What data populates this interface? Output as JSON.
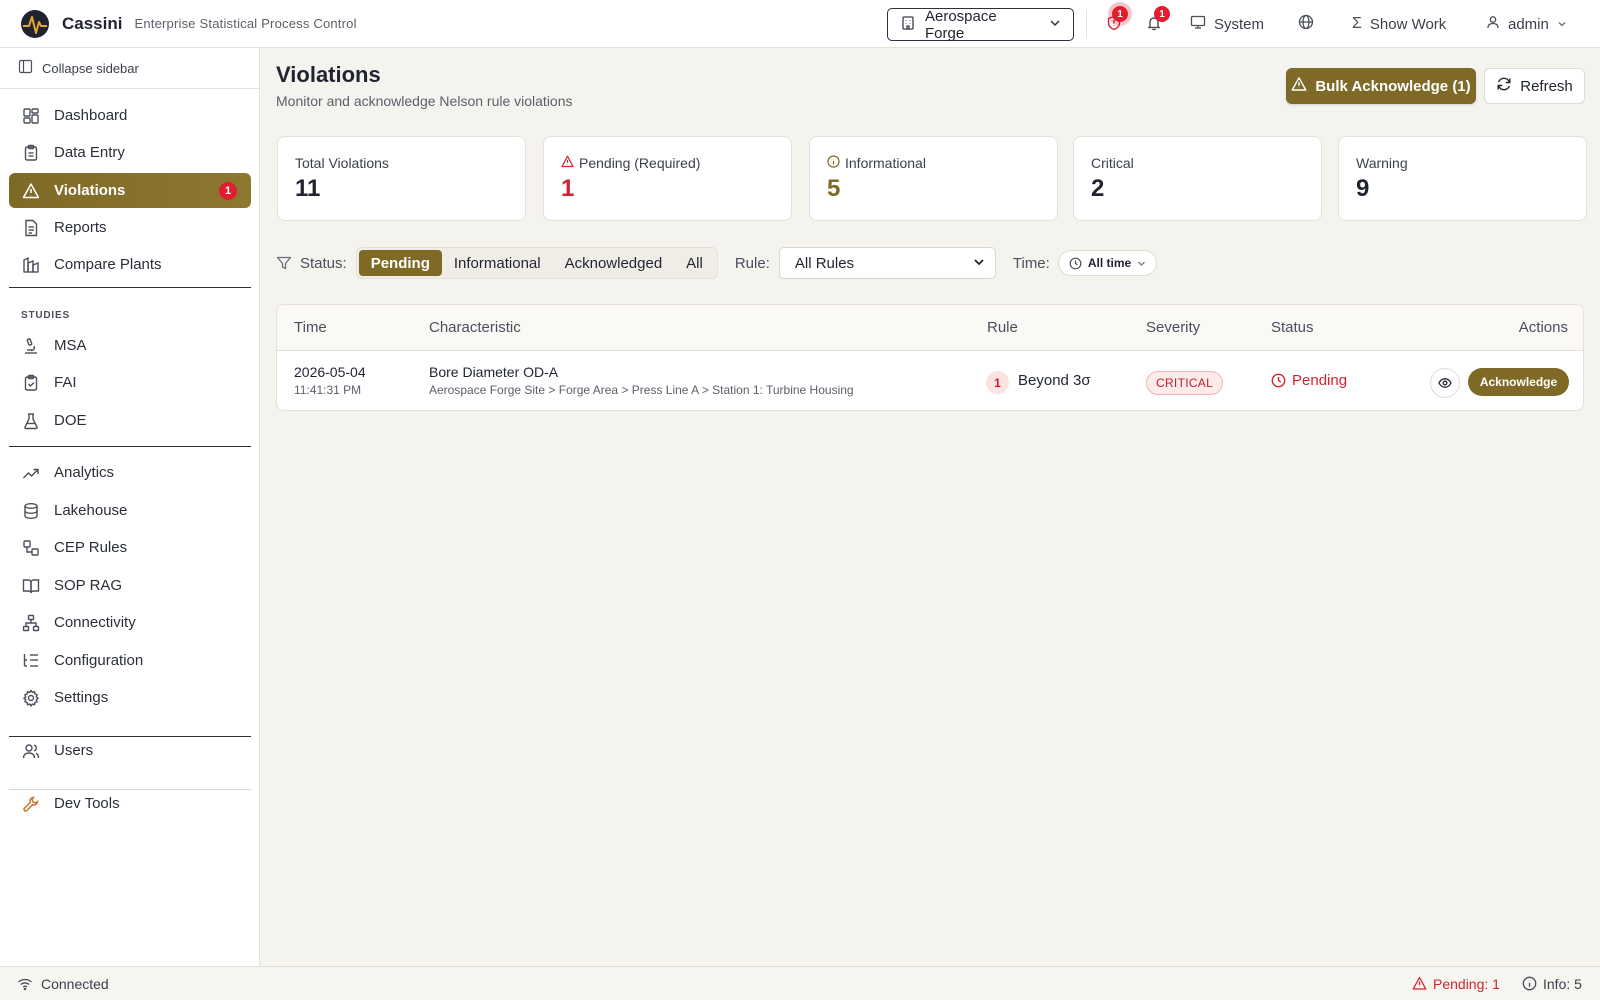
{
  "app": {
    "name": "Cassini",
    "subtitle": "Enterprise Statistical Process Control"
  },
  "topbar": {
    "plant": "Aerospace Forge",
    "violations_badge": "1",
    "notifications_badge": "1",
    "system_label": "System",
    "show_work_label": "Show Work",
    "user_label": "admin"
  },
  "sidebar": {
    "collapse_label": "Collapse sidebar",
    "main_items": [
      {
        "label": "Dashboard",
        "icon": "dashboard-icon"
      },
      {
        "label": "Data Entry",
        "icon": "clipboard-icon"
      },
      {
        "label": "Violations",
        "icon": "warning-icon",
        "active": true,
        "count": "1"
      },
      {
        "label": "Reports",
        "icon": "file-text-icon"
      },
      {
        "label": "Compare Plants",
        "icon": "factory-icon"
      }
    ],
    "studies_heading": "STUDIES",
    "study_items": [
      {
        "label": "MSA",
        "icon": "microscope-icon"
      },
      {
        "label": "FAI",
        "icon": "clipboard-check-icon"
      },
      {
        "label": "DOE",
        "icon": "flask-icon"
      }
    ],
    "tool_items": [
      {
        "label": "Analytics",
        "icon": "trending-up-icon"
      },
      {
        "label": "Lakehouse",
        "icon": "database-icon"
      },
      {
        "label": "CEP Rules",
        "icon": "workflow-icon"
      },
      {
        "label": "SOP RAG",
        "icon": "book-icon"
      },
      {
        "label": "Connectivity",
        "icon": "network-icon"
      },
      {
        "label": "Configuration",
        "icon": "list-tree-icon"
      },
      {
        "label": "Settings",
        "icon": "gear-icon"
      }
    ],
    "admin_items": [
      {
        "label": "Users",
        "icon": "users-icon"
      }
    ],
    "dev_items": [
      {
        "label": "Dev Tools",
        "icon": "wrench-icon"
      }
    ]
  },
  "page": {
    "title": "Violations",
    "subtitle": "Monitor and acknowledge Nelson rule violations",
    "bulk_ack_label": "Bulk Acknowledge (1)",
    "refresh_label": "Refresh"
  },
  "stats": [
    {
      "label": "Total Violations",
      "value": "11",
      "color": "#1f2430"
    },
    {
      "label": "Pending (Required)",
      "value": "1",
      "color": "#d42330"
    },
    {
      "label": "Informational",
      "value": "5",
      "color": "#7e6a26"
    },
    {
      "label": "Critical",
      "value": "2",
      "color": "#1f2430"
    },
    {
      "label": "Warning",
      "value": "9",
      "color": "#1f2430"
    }
  ],
  "filters": {
    "status_label": "Status:",
    "status_options": [
      "Pending",
      "Informational",
      "Acknowledged",
      "All"
    ],
    "status_selected": "Pending",
    "rule_label": "Rule:",
    "rule_value": "All Rules",
    "time_label": "Time:",
    "time_value": "All time"
  },
  "table": {
    "columns": [
      "Time",
      "Characteristic",
      "Rule",
      "Severity",
      "Status",
      "Actions"
    ],
    "rows": [
      {
        "date": "2026-05-04",
        "time": "11:41:31 PM",
        "characteristic": "Bore Diameter OD-A",
        "path": "Aerospace Forge Site > Forge Area > Press Line A > Station 1: Turbine Housing",
        "rule_number": "1",
        "rule_name": "Beyond 3σ",
        "severity": "CRITICAL",
        "status": "Pending",
        "action_label": "Acknowledge"
      }
    ]
  },
  "statusbar": {
    "connection": "Connected",
    "pending": "Pending: 1",
    "info": "Info: 5"
  },
  "colors": {
    "accent": "#7e6a26",
    "danger": "#d42330",
    "background": "#f5f3ee"
  }
}
